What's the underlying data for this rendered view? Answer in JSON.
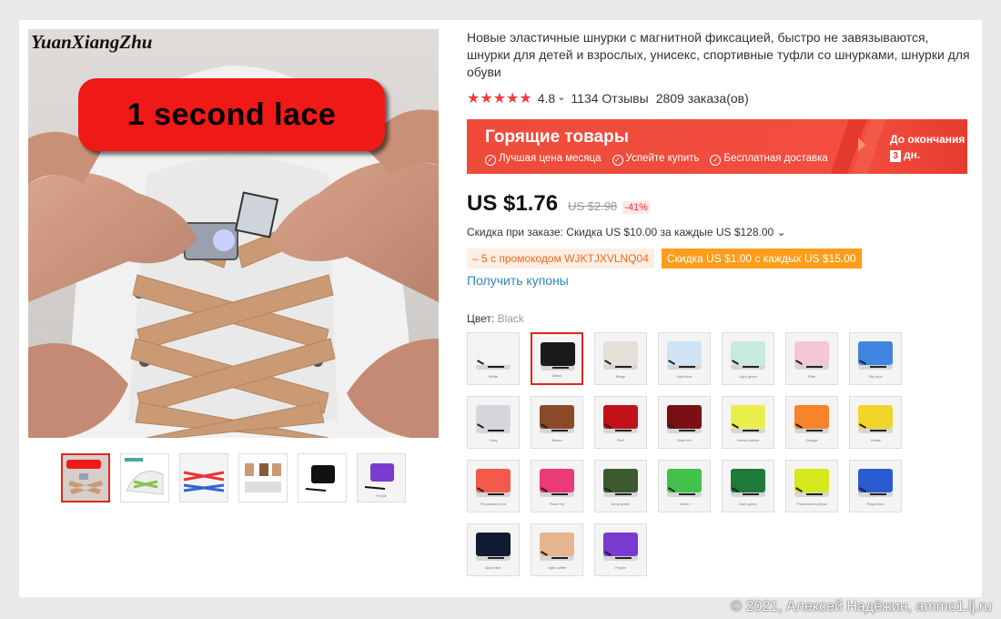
{
  "gallery": {
    "brand": "YuanXiangZhu",
    "banner_text": "1 second lace",
    "thumbnails": [
      {
        "label": ""
      },
      {
        "label": ""
      },
      {
        "label": ""
      },
      {
        "label": ""
      },
      {
        "label": ""
      },
      {
        "label": "Purple"
      }
    ]
  },
  "product": {
    "title": "Новые эластичные шнурки с магнитной фиксацией, быстро не завязываются, шнурки для детей и взрослых, унисекс, спортивные туфли со шнурками, шнурки для обуви",
    "stars": "★★★★★",
    "rating": "4.8",
    "rating_caret": "⌄",
    "reviews": "1134 Отзывы",
    "orders": "2809 заказа(ов)"
  },
  "hot_deals": {
    "title": "Горящие товары",
    "features": [
      "Лучшая цена месяца",
      "Успейте купить",
      "Бесплатная доставка"
    ],
    "ends_label": "До окончания",
    "days_count": "3",
    "days_unit": "дн."
  },
  "pricing": {
    "price": "US $1.76",
    "old_price": "US $2.98",
    "discount": "-41%",
    "order_discount": "Скидка при заказе: Скидка US $10.00 за каждые US $128.00 ⌄",
    "promo_code": "– 5 с промокодом WJKTJXVLNQ04",
    "promo_deal": "Скидка US $1.00 с каждых US $15.00",
    "coupons_link": "Получить купоны"
  },
  "color_selector": {
    "label": "Цвет:",
    "selected": "Black",
    "options": [
      {
        "name": "White",
        "color": "#f3f3f3"
      },
      {
        "name": "Black",
        "color": "#1a1a1a"
      },
      {
        "name": "Beige",
        "color": "#e4e0d8"
      },
      {
        "name": "Light blue",
        "color": "#cfe3f5"
      },
      {
        "name": "Light green",
        "color": "#c6eadf"
      },
      {
        "name": "Pink",
        "color": "#f6c6d6"
      },
      {
        "name": "Sky blue",
        "color": "#3f86e0"
      },
      {
        "name": "Gray",
        "color": "#d4d6da"
      },
      {
        "name": "Brown",
        "color": "#8a4a2a"
      },
      {
        "name": "Red",
        "color": "#c1121c"
      },
      {
        "name": "Dark red",
        "color": "#7a1014"
      },
      {
        "name": "Lemon yellow",
        "color": "#e9ef4a"
      },
      {
        "name": "Orange",
        "color": "#f7832b"
      },
      {
        "name": "Yellow",
        "color": "#f2d52a"
      },
      {
        "name": "Fluorescent red",
        "color": "#f45a4a"
      },
      {
        "name": "Rose red",
        "color": "#ea3a78"
      },
      {
        "name": "Army green",
        "color": "#3c5a2e"
      },
      {
        "name": "Green",
        "color": "#42c24a"
      },
      {
        "name": "Dark green",
        "color": "#1f7a3a"
      },
      {
        "name": "Fluorescent yellow",
        "color": "#d6e81e"
      },
      {
        "name": "Royal blue",
        "color": "#2a5ccf"
      },
      {
        "name": "Navy blue",
        "color": "#101a30"
      },
      {
        "name": "Light coffee",
        "color": "#e6b48f"
      },
      {
        "name": "Purple",
        "color": "#7a3bd0"
      }
    ]
  },
  "credit": "© 2021, Алексей Надёжин, ammo1.lj.ru"
}
